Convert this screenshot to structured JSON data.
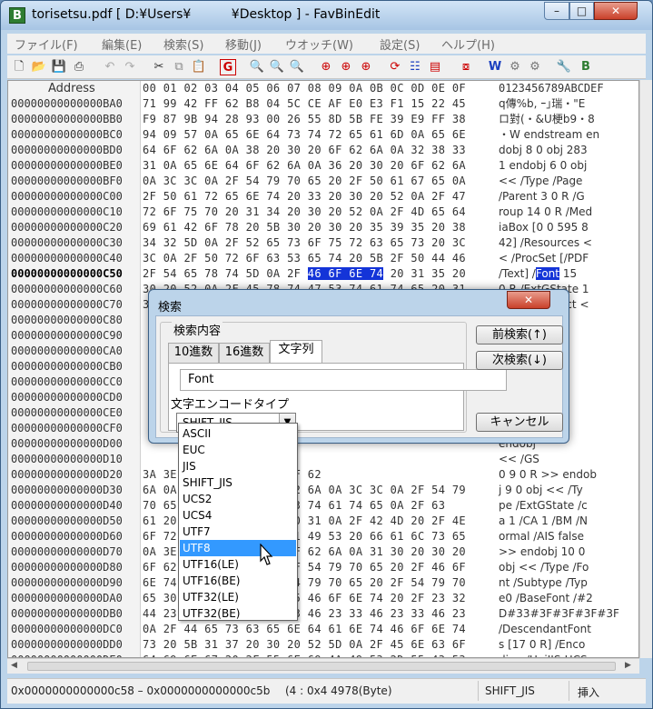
{
  "window": {
    "title": "torisetsu.pdf [ D:¥Users¥          ¥Desktop ] - FavBinEdit",
    "app_icon_letter": "B",
    "close_glyph": "✕"
  },
  "menu": [
    "ファイル(F)",
    "編集(E)",
    "検索(S)",
    "移動(J)",
    "ウオッチ(W)",
    "設定(S)",
    "ヘルプ(H)"
  ],
  "toolbar_icons": [
    "new-icon",
    "open-icon",
    "save-icon",
    "print-icon",
    "undo-icon",
    "redo-icon",
    "cut-icon",
    "copy-icon",
    "paste-icon",
    "goto-icon",
    "find-icon",
    "find-next-icon",
    "find-prev-icon",
    "zoom-icon",
    "zoom-next-icon",
    "zoom-prev-icon",
    "watch-icon",
    "list-icon",
    "compare-icon",
    "split-icon",
    "web-icon",
    "tools-icon",
    "settings-icon",
    "help-icon"
  ],
  "hex": {
    "address_header": "Address",
    "column_header": "00 01 02 03 04 05 06 07 08 09 0A 0B 0C 0D 0E 0F",
    "text_header": "0123456789ABCDEF",
    "rows": [
      {
        "addr": "00000000000000BA0",
        "hex": "71 99 42 FF 62 B8 04 5C CE AF E0 E3 F1 15 22 45",
        "txt": "q傳%b, ｰ｣瑞・\"E"
      },
      {
        "addr": "00000000000000BB0",
        "hex": "F9 87 9B 94 28 93 00 26 55 8D 5B FE 39 E9 FF 38",
        "txt": "ロ對(・&U梗b9・8"
      },
      {
        "addr": "00000000000000BC0",
        "hex": "94 09 57 0A 65 6E 64 73 74 72 65 61 6D 0A 65 6E",
        "txt": "・W endstream en"
      },
      {
        "addr": "00000000000000BD0",
        "hex": "64 6F 62 6A 0A 38 20 30 20 6F 62 6A 0A 32 38 33",
        "txt": "dobj 8 0 obj 283"
      },
      {
        "addr": "00000000000000BE0",
        "hex": "31 0A 65 6E 64 6F 62 6A 0A 36 20 30 20 6F 62 6A",
        "txt": "1 endobj 6 0 obj"
      },
      {
        "addr": "00000000000000BF0",
        "hex": "0A 3C 3C 0A 2F 54 79 70 65 20 2F 50 61 67 65 0A",
        "txt": " << /Type /Page"
      },
      {
        "addr": "00000000000000C00",
        "hex": "2F 50 61 72 65 6E 74 20 33 20 30 20 52 0A 2F 47",
        "txt": "/Parent 3 0 R /G"
      },
      {
        "addr": "00000000000000C10",
        "hex": "72 6F 75 70 20 31 34 20 30 20 52 0A 2F 4D 65 64",
        "txt": "roup 14 0 R /Med"
      },
      {
        "addr": "00000000000000C20",
        "hex": "69 61 42 6F 78 20 5B 30 20 30 20 35 39 35 20 38",
        "txt": "iaBox [0 0 595 8"
      },
      {
        "addr": "00000000000000C30",
        "hex": "34 32 5D 0A 2F 52 65 73 6F 75 72 63 65 73 20 3C",
        "txt": "42] /Resources <"
      },
      {
        "addr": "00000000000000C40",
        "hex": "3C 0A 2F 50 72 6F 63 53 65 74 20 5B 2F 50 44 46",
        "txt": "< /ProcSet [/PDF"
      },
      {
        "addr": "00000000000000C50",
        "hex": "2F 54 65 78 74 5D 0A 2F 46 6F 6E 74 20 31 35 20",
        "txt": "/Text] /Font 15 ",
        "current": true
      },
      {
        "addr": "00000000000000C60",
        "hex": "30 20 52 0A 2F 45 78 74 47 53 74 61 74 65 20 31",
        "txt": "0 R /ExtGState 1"
      },
      {
        "addr": "00000000000000C70",
        "hex": "36 20 30 20 52 0A 2F 58 4F 62 6A 65 63 74 20 3C",
        "txt": "6 0 R /XObject <"
      },
      {
        "addr": "00000000000000C80",
        "hex": "",
        "txt": "4 0 R]"
      },
      {
        "addr": "00000000000000C90",
        "hex": "",
        "txt": "14 0"
      },
      {
        "addr": "00000000000000CA0",
        "hex": "",
        "txt": "ype /Gr"
      },
      {
        "addr": "00000000000000CB0",
        "hex": "",
        "txt": "ranspar"
      },
      {
        "addr": "00000000000000CC0",
        "hex": "",
        "txt": "false /K"
      },
      {
        "addr": "00000000000000CD0",
        "hex": "",
        "txt": "e /Devi"
      },
      {
        "addr": "00000000000000CE0",
        "hex": "",
        "txt": "endobj"
      },
      {
        "addr": "00000000000000CF0",
        "hex": "",
        "txt": " /F0"
      },
      {
        "addr": "00000000000000D00",
        "hex": "",
        "txt": "endobj"
      },
      {
        "addr": "00000000000000D10",
        "hex": "",
        "txt": " << /GS"
      },
      {
        "addr": "00000000000000D20",
        "hex": "      3A 3E 3E 0A 65 6E 64 6F 62",
        "txt": "0 9 0 R >> endob"
      },
      {
        "addr": "00000000000000D30",
        "hex": "6A 0A 39 20 30 20 6F 62 6A 0A 3C 3C 0A 2F 54 79",
        "txt": "j 9 0 obj << /Ty"
      },
      {
        "addr": "00000000000000D40",
        "hex": "70 65 2F 45 78 74 47 53 74 61 74 65 0A 2F 63",
        "txt": "pe /ExtGState /c"
      },
      {
        "addr": "00000000000000D50",
        "hex": "61 20 31 0A 2F 43 41 20 31 0A 2F 42 4D 20 2F 4E",
        "txt": "a 1 /CA 1 /BM /N"
      },
      {
        "addr": "00000000000000D60",
        "hex": "6F 72 6D 61 6C 20 2F 41 49 53 20 66 61 6C 73 65",
        "txt": "ormal /AIS false"
      },
      {
        "addr": "00000000000000D70",
        "hex": "0A 3E 3E 0A 65 6E 64 6F 62 6A 0A 31 30 20 30 20",
        "txt": " >> endobj 10 0"
      },
      {
        "addr": "00000000000000D80",
        "hex": "6F 62 6A 20 3C 3C 20 2F 54 79 70 65 20 2F 46 6F",
        "txt": "obj << /Type /Fo"
      },
      {
        "addr": "00000000000000D90",
        "hex": "6E 74 20 2F 53 75 62 74 79 70 65 20 2F 54 79 70",
        "txt": "nt /Subtype /Typ"
      },
      {
        "addr": "00000000000000DA0",
        "hex": "65 30 20 2F 42 61 73 65 46 6F 6E 74 20 2F 23 32",
        "txt": "e0 /BaseFont /#2"
      },
      {
        "addr": "00000000000000DB0",
        "hex": "44 23 33 23 33 46 23 33 46 23 33 46 23 33 46 23",
        "txt": "D#33#3F#3F#3F#3F"
      },
      {
        "addr": "00000000000000DC0",
        "hex": "0A 2F 44 65 73 63 65 6E 64 61 6E 74 46 6F 6E 74",
        "txt": " /DescendantFont"
      },
      {
        "addr": "00000000000000DD0",
        "hex": "73 20 5B 31 37 20 30 20 52 5D 0A 2F 45 6E 63 6F",
        "txt": "s [17 0 R] /Enco"
      },
      {
        "addr": "00000000000000DE0",
        "hex": "64 69 6E 67 20 2F 55 6E 69 4A 49 53 2D 55 43 53",
        "txt": "ding /UniJIS-UCS"
      },
      {
        "addr": "00000000000000DF0",
        "hex": "32 2D 48 20 3E 3E 0A 65 6E 64 6F 62 6A 20 31 37",
        "txt": "2-H >> endobj 17"
      }
    ]
  },
  "status": {
    "range": "0x0000000000000c58 – 0x0000000000000c5b",
    "length": "(4 : 0x4  4978(Byte)",
    "encoding": "SHIFT_JIS",
    "mode": "挿入"
  },
  "dialog": {
    "title": "検索",
    "close_glyph": "✕",
    "group_label": "検索内容",
    "tabs": [
      "10進数",
      "16進数",
      "文字列"
    ],
    "search_text": "Font",
    "encoding_label": "文字エンコードタイプ",
    "encoding_value": "SHIFT_JIS",
    "find_prev": "前検索(↑)",
    "find_next": "次検索(↓)",
    "cancel": "キャンセル"
  },
  "encoding_options": [
    "ASCII",
    "EUC",
    "JIS",
    "SHIFT_JIS",
    "UCS2",
    "UCS4",
    "UTF7",
    "UTF8",
    "UTF16(LE)",
    "UTF16(BE)",
    "UTF32(LE)",
    "UTF32(BE)"
  ],
  "highlighted_option": "UTF8",
  "colors": {
    "selection": "#1434d8",
    "highlight": "#3399ff",
    "title_bg": "#bcd4ea"
  }
}
